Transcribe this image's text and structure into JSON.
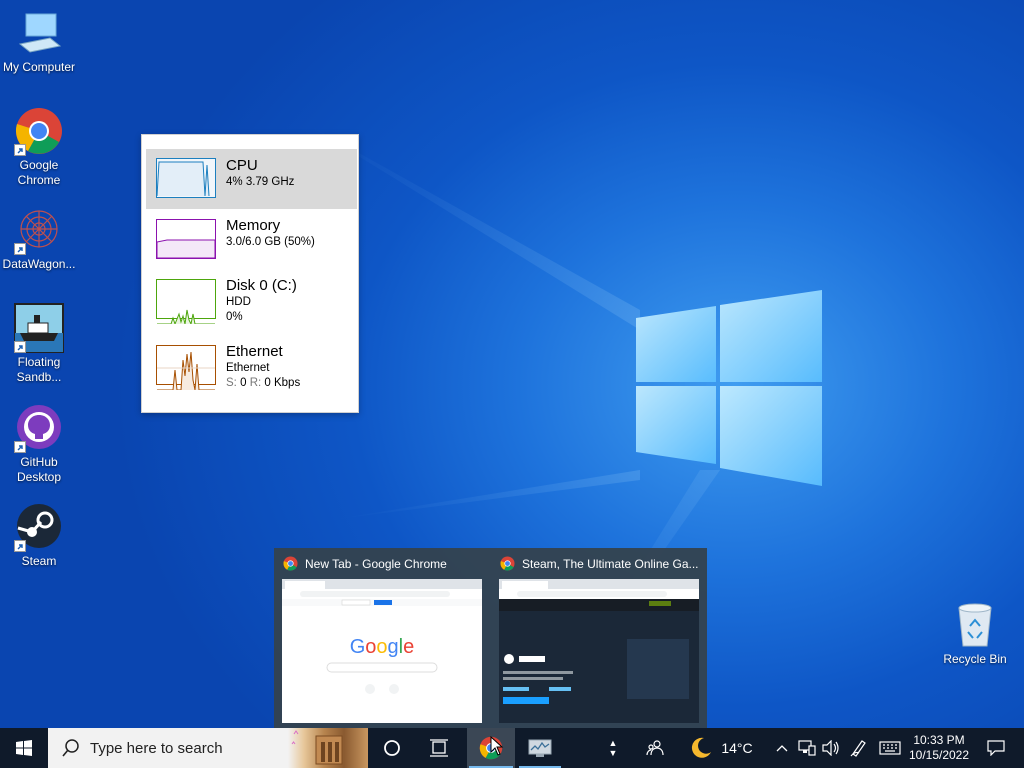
{
  "desktop": {
    "icons": [
      {
        "label": "My Computer"
      },
      {
        "label": "Google Chrome"
      },
      {
        "label": "DataWagon..."
      },
      {
        "label": "Floating Sandb..."
      },
      {
        "label": "GitHub Desktop"
      },
      {
        "label": "Steam"
      }
    ],
    "recycle_bin": "Recycle Bin"
  },
  "perf_popup": {
    "items": [
      {
        "title": "CPU",
        "line1": "4% 3.79 GHz",
        "color": "#1c7fbf"
      },
      {
        "title": "Memory",
        "line1": "3.0/6.0 GB (50%)",
        "color": "#8b12ae"
      },
      {
        "title": "Disk 0 (C:)",
        "line1": "HDD",
        "line2": "0%",
        "color": "#4da60c"
      },
      {
        "title": "Ethernet",
        "line1": "Ethernet",
        "s_label": "S:",
        "s_val": "0",
        "r_label": "R:",
        "r_val": "0 Kbps",
        "color": "#a74f01"
      }
    ]
  },
  "thumbnails": [
    {
      "title": "New Tab - Google Chrome"
    },
    {
      "title": "Steam, The Ultimate Online Ga..."
    }
  ],
  "taskbar": {
    "search_placeholder": "Type here to search",
    "weather_temp": "14°C",
    "time": "10:33 PM",
    "date": "10/15/2022"
  },
  "colors": {
    "accent": "#0078d7",
    "taskbar": "#0f1a2a"
  }
}
